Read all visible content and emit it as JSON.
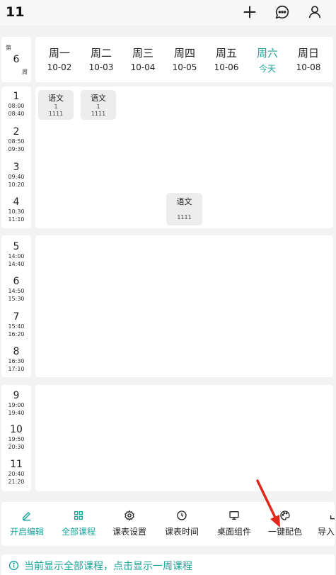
{
  "app": {
    "title": "11"
  },
  "header_icons": [
    "plus-icon",
    "message-icon",
    "user-icon"
  ],
  "week": {
    "top": "第",
    "number": "6",
    "bottom": "周"
  },
  "days": [
    {
      "name": "周一",
      "date": "10-02"
    },
    {
      "name": "周二",
      "date": "10-03"
    },
    {
      "name": "周三",
      "date": "10-04"
    },
    {
      "name": "周四",
      "date": "10-05"
    },
    {
      "name": "周五",
      "date": "10-06"
    },
    {
      "name": "周六",
      "date": "今天"
    },
    {
      "name": "周日",
      "date": "10-08"
    }
  ],
  "periods": [
    {
      "num": "1",
      "start": "08:00",
      "end": "08:40"
    },
    {
      "num": "2",
      "start": "08:50",
      "end": "09:30"
    },
    {
      "num": "3",
      "start": "09:40",
      "end": "10:20"
    },
    {
      "num": "4",
      "start": "10:30",
      "end": "11:10"
    },
    {
      "num": "5",
      "start": "14:00",
      "end": "14:40"
    },
    {
      "num": "6",
      "start": "14:50",
      "end": "15:30"
    },
    {
      "num": "7",
      "start": "15:40",
      "end": "16:20"
    },
    {
      "num": "8",
      "start": "16:30",
      "end": "17:10"
    },
    {
      "num": "9",
      "start": "19:00",
      "end": "19:40"
    },
    {
      "num": "10",
      "start": "19:50",
      "end": "20:30"
    },
    {
      "num": "11",
      "start": "20:40",
      "end": "21:20"
    }
  ],
  "courses": [
    {
      "name": "语文",
      "line1": "1",
      "line2": "1111"
    },
    {
      "name": "语文",
      "line1": "1",
      "line2": "1111"
    },
    {
      "name": "语文",
      "line1": "",
      "line2": "1111"
    }
  ],
  "toolbar": [
    {
      "label": "开启编辑",
      "icon": "pencil-icon"
    },
    {
      "label": "全部课程",
      "icon": "grid-icon"
    },
    {
      "label": "课表设置",
      "icon": "gear-icon"
    },
    {
      "label": "课表时间",
      "icon": "clock-icon"
    },
    {
      "label": "桌面组件",
      "icon": "monitor-icon"
    },
    {
      "label": "一键配色",
      "icon": "palette-icon"
    },
    {
      "label": "导入",
      "icon": "import-icon"
    }
  ],
  "banner": {
    "text": "当前显示全部课程，点击显示一周课程",
    "icon": "info-icon"
  },
  "colors": {
    "accent": "#1aa39a",
    "background": "#f2f2f2",
    "course_bg": "#ececec",
    "arrow": "#e0271a"
  }
}
